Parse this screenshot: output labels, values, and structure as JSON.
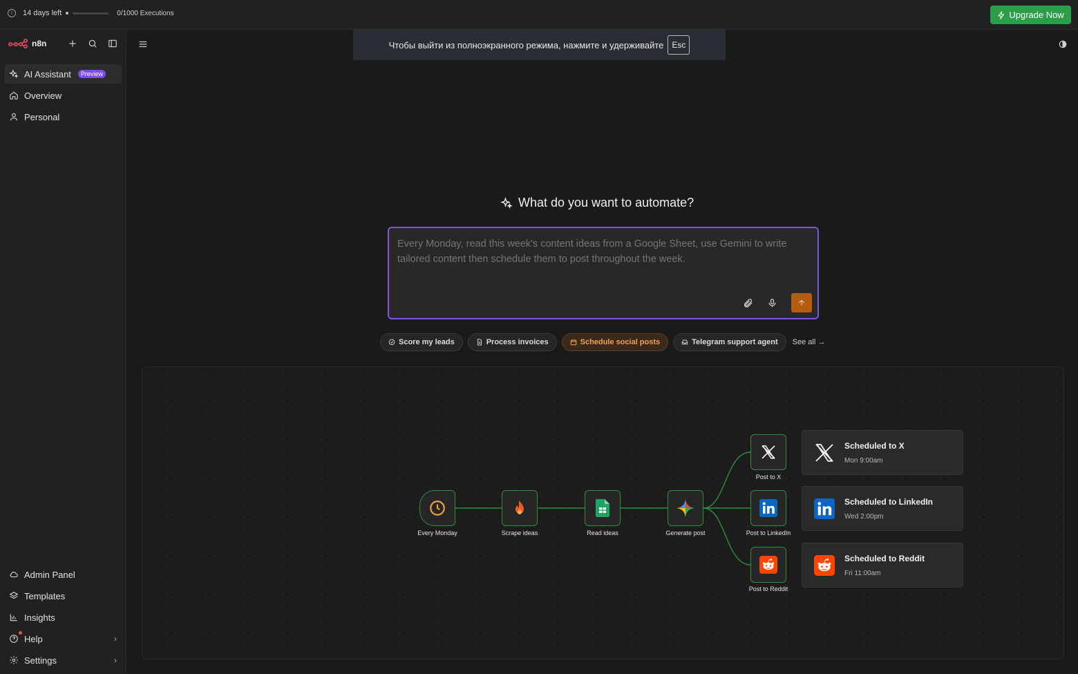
{
  "topbar": {
    "trial_text": "14 days left",
    "executions": "0/1000 Executions",
    "upgrade_label": "Upgrade Now"
  },
  "sidebar": {
    "brand": "n8n",
    "items": [
      {
        "label": "AI Assistant",
        "badge": "Preview"
      },
      {
        "label": "Overview"
      },
      {
        "label": "Personal"
      }
    ],
    "bottom_items": [
      {
        "label": "Admin Panel"
      },
      {
        "label": "Templates"
      },
      {
        "label": "Insights"
      },
      {
        "label": "Help"
      },
      {
        "label": "Settings"
      }
    ]
  },
  "fullscreen_banner": {
    "text": "Чтобы выйти из полноэкранного режима, нажмите и удерживайте",
    "key": "Esc"
  },
  "main": {
    "heading": "What do you want to automate?",
    "prompt_placeholder": "Every Monday, read this week's content ideas from a Google Sheet, use Gemini to write tailored content then schedule them to post throughout the week.",
    "chips": [
      {
        "label": "Score my leads",
        "icon": "check-circle-icon"
      },
      {
        "label": "Process invoices",
        "icon": "document-icon"
      },
      {
        "label": "Schedule social posts",
        "icon": "calendar-icon",
        "highlighted": true
      },
      {
        "label": "Telegram support agent",
        "icon": "inbox-icon"
      }
    ],
    "see_all": "See all"
  },
  "workflow": {
    "nodes": [
      {
        "label": "Every Monday",
        "icon": "clock-icon"
      },
      {
        "label": "Scrape ideas",
        "icon": "flame-icon"
      },
      {
        "label": "Read ideas",
        "icon": "google-sheets-icon"
      },
      {
        "label": "Generate post",
        "icon": "gemini-icon"
      },
      {
        "label": "Post to X",
        "icon": "x-logo-icon"
      },
      {
        "label": "Post to LinkedIn",
        "icon": "linkedin-icon"
      },
      {
        "label": "Post to Reddit",
        "icon": "reddit-icon"
      }
    ],
    "results": [
      {
        "title": "Scheduled to X",
        "time": "Mon 9:00am"
      },
      {
        "title": "Scheduled to LinkedIn",
        "time": "Wed 2:00pm"
      },
      {
        "title": "Scheduled to Reddit",
        "time": "Fri 11:00am"
      }
    ]
  },
  "colors": {
    "accent_purple": "#7f56d9",
    "upgrade_green": "#2c9e4a",
    "send_orange": "#b35c12",
    "node_border_green": "#2c8f44"
  }
}
